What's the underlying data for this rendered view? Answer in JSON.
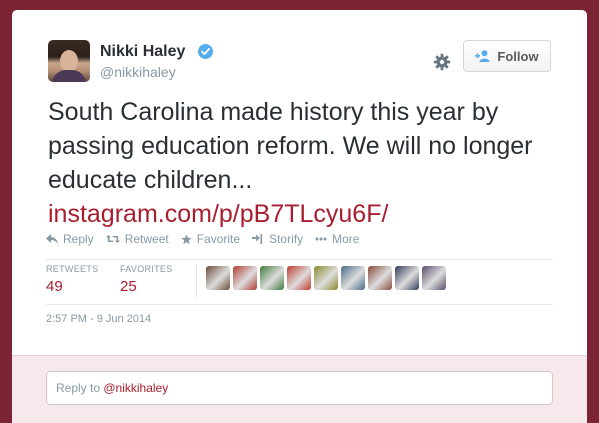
{
  "user": {
    "name": "Nikki Haley",
    "handle": "@nikkihaley"
  },
  "follow_button": {
    "label": "Follow"
  },
  "tweet": {
    "text": "South Carolina made history this year by passing education reform. We will no longer educate children...",
    "link": "instagram.com/p/pB7TLcyu6F/"
  },
  "actions": [
    {
      "label": "Reply",
      "icon": "reply-icon"
    },
    {
      "label": "Retweet",
      "icon": "retweet-icon"
    },
    {
      "label": "Favorite",
      "icon": "star-icon"
    },
    {
      "label": "Storify",
      "icon": "storify-icon"
    },
    {
      "label": "More",
      "icon": "more-icon"
    }
  ],
  "stats": {
    "retweets_label": "RETWEETS",
    "retweets_value": "49",
    "favorites_label": "FAVORITES",
    "favorites_value": "25"
  },
  "favoriter_avatars": [
    {
      "color": "#6b4a3a"
    },
    {
      "color": "#b23a2e"
    },
    {
      "color": "#3f7a3a"
    },
    {
      "color": "#c0392b"
    },
    {
      "color": "#8a8a2e"
    },
    {
      "color": "#4a6a8a"
    },
    {
      "color": "#8a4a3a"
    },
    {
      "color": "#2e3a5a"
    },
    {
      "color": "#5a4a6a"
    }
  ],
  "timestamp": "2:57 PM - 9 Jun 2014",
  "reply": {
    "prefix": "Reply to ",
    "mention": "@nikkihaley"
  },
  "colors": {
    "background": "#7a2434",
    "link": "#a91d2f",
    "reply_area": "#f7e8ec",
    "verified": "#55acee"
  }
}
